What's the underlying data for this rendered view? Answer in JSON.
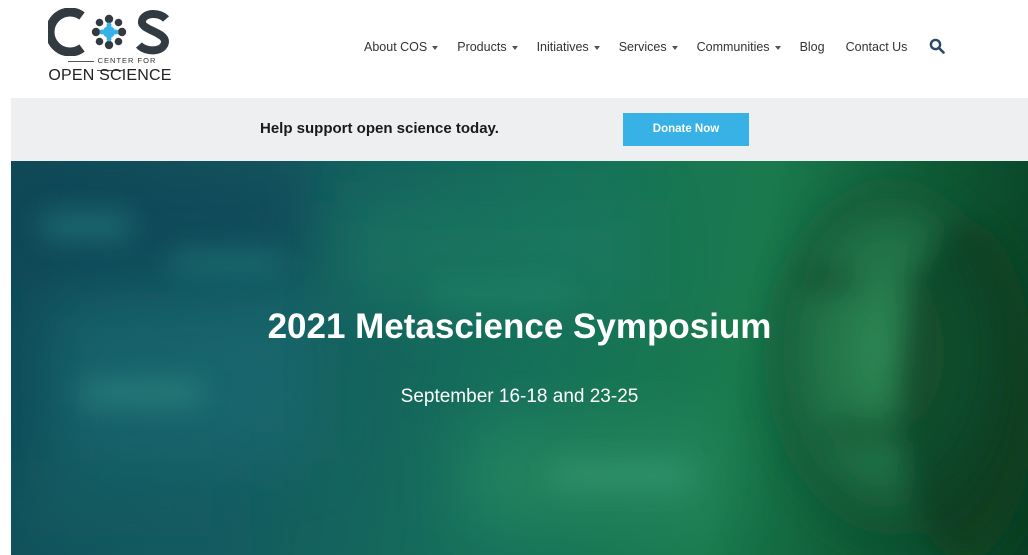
{
  "logo": {
    "letters": "COS",
    "line1": "CENTER FOR",
    "line2": "OPEN SCIENCE"
  },
  "nav": {
    "items": [
      {
        "label": "About COS",
        "dropdown": true
      },
      {
        "label": "Products",
        "dropdown": true
      },
      {
        "label": "Initiatives",
        "dropdown": true
      },
      {
        "label": "Services",
        "dropdown": true
      },
      {
        "label": "Communities",
        "dropdown": true
      },
      {
        "label": "Blog",
        "dropdown": false
      },
      {
        "label": "Contact Us",
        "dropdown": false
      }
    ],
    "search_icon": "search-icon"
  },
  "donate": {
    "text": "Help support open science today.",
    "button_label": "Donate Now"
  },
  "hero": {
    "title": "2021 Metascience Symposium",
    "subtitle": "September 16-18 and 23-25"
  },
  "colors": {
    "accent": "#37b1e6",
    "donate_bar": "#eeeff0",
    "logo_dark": "#333b42",
    "hero_green": "#16705a"
  }
}
